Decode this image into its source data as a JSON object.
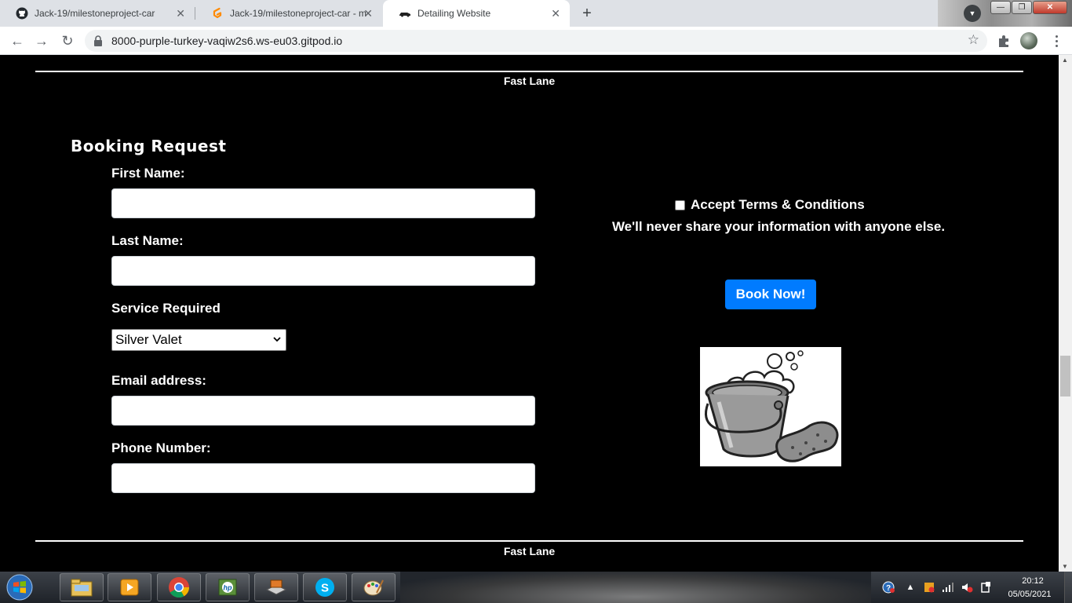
{
  "browser": {
    "tabs": [
      {
        "title": "Jack-19/milestoneproject-car",
        "icon": "github-icon"
      },
      {
        "title": "Jack-19/milestoneproject-car - m",
        "icon": "gitpod-icon"
      },
      {
        "title": "Detailing Website",
        "icon": "car-icon"
      }
    ],
    "url": "8000-purple-turkey-vaqiw2s6.ws-eu03.gitpod.io",
    "colors": {
      "tabbar": "#dee1e6",
      "active_tab": "#ffffff"
    }
  },
  "page": {
    "brand": "Fast Lane",
    "footer_brand": "Fast Lane",
    "form": {
      "title": "Booking Request",
      "first_name_label": "First Name:",
      "last_name_label": "Last Name:",
      "service_label": "Service Required",
      "service_selected": "Silver Valet",
      "email_label": "Email address:",
      "phone_label": "Phone Number:",
      "first_name_value": "",
      "last_name_value": "",
      "email_value": "",
      "phone_value": ""
    },
    "terms_label": "Accept Terms & Conditions",
    "terms_checked": false,
    "privacy_note": "We'll never share your information with anyone else.",
    "book_button": "Book Now!",
    "image": "bucket-and-sponge-illustration",
    "colors": {
      "background": "#000000",
      "text": "#ffffff",
      "button": "#007bff"
    }
  },
  "taskbar": {
    "apps": [
      "file-explorer-icon",
      "media-player-icon",
      "chrome-icon",
      "hp-icon",
      "scanner-icon",
      "skype-icon",
      "paint-icon"
    ],
    "clock_time": "20:12",
    "clock_date": "05/05/2021"
  }
}
